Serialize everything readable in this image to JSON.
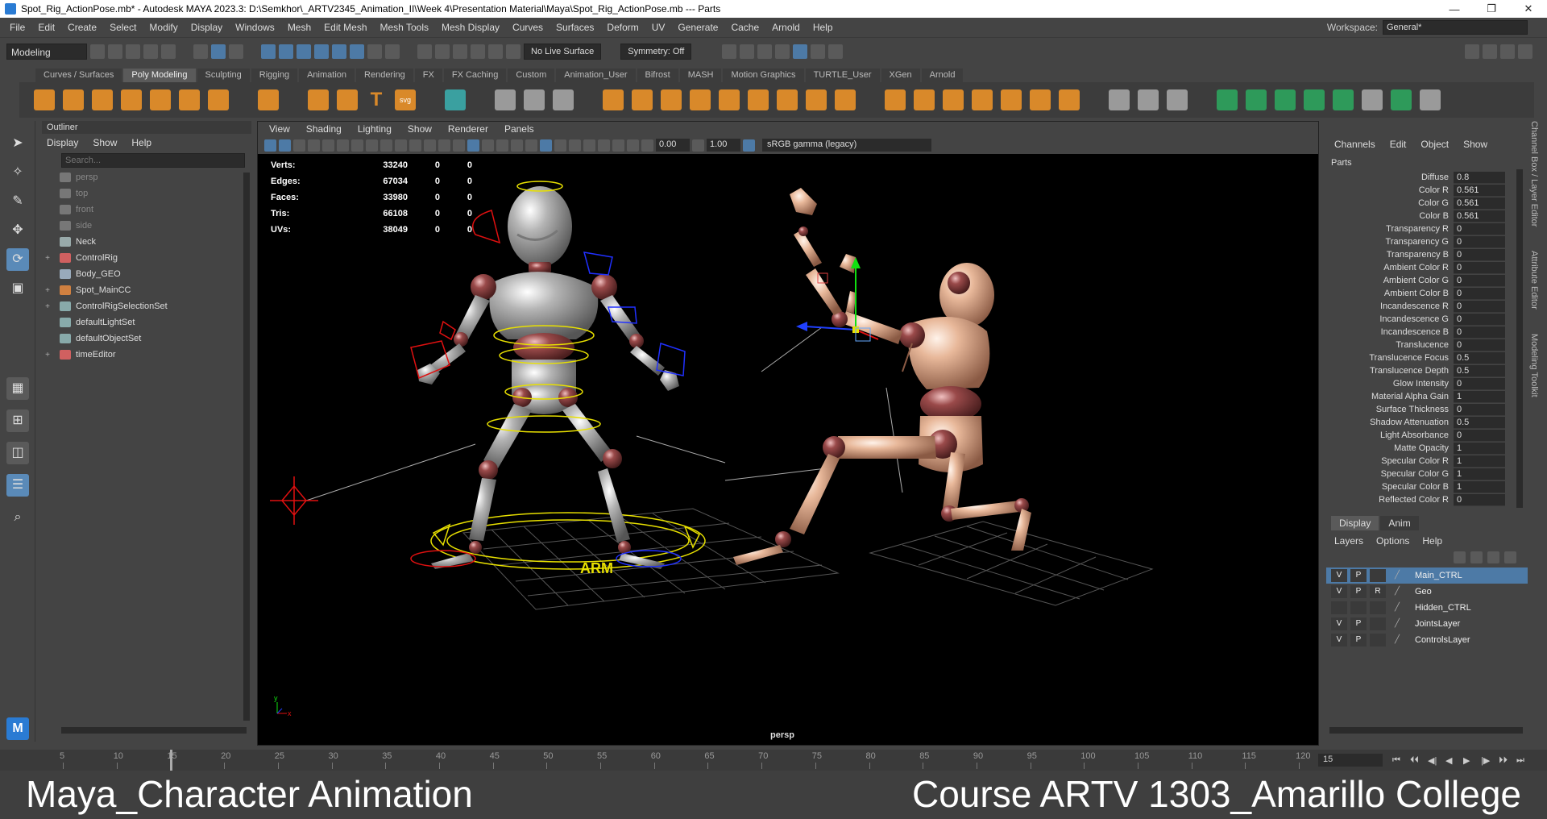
{
  "titlebar": {
    "title": "Spot_Rig_ActionPose.mb* - Autodesk MAYA 2023.3: D:\\Semkhor\\_ARTV2345_Animation_II\\Week 4\\Presentation Material\\Maya\\Spot_Rig_ActionPose.mb   ---   Parts",
    "min": "—",
    "max": "❐",
    "close": "✕"
  },
  "menubar": {
    "items": [
      "File",
      "Edit",
      "Create",
      "Select",
      "Modify",
      "Display",
      "Windows",
      "Mesh",
      "Edit Mesh",
      "Mesh Tools",
      "Mesh Display",
      "Curves",
      "Surfaces",
      "Deform",
      "UV",
      "Generate",
      "Cache",
      "Arnold",
      "Help"
    ],
    "workspace_label": "Workspace:",
    "workspace_value": "General*"
  },
  "statusline": {
    "mode": "Modeling",
    "live_surface": "No Live Surface",
    "symmetry": "Symmetry: Off"
  },
  "shelf": {
    "tabs": [
      "Curves / Surfaces",
      "Poly Modeling",
      "Sculpting",
      "Rigging",
      "Animation",
      "Rendering",
      "FX",
      "FX Caching",
      "Custom",
      "Animation_User",
      "Bifrost",
      "MASH",
      "Motion Graphics",
      "TURTLE_User",
      "XGen",
      "Arnold"
    ],
    "active": "Poly Modeling",
    "text_icon": "T",
    "svg_icon": "svg"
  },
  "outliner": {
    "title": "Outliner",
    "menu": [
      "Display",
      "Show",
      "Help"
    ],
    "search_placeholder": "Search...",
    "items": [
      {
        "label": "persp",
        "expand": "",
        "dim": true,
        "color": "#777"
      },
      {
        "label": "top",
        "expand": "",
        "dim": true,
        "color": "#777"
      },
      {
        "label": "front",
        "expand": "",
        "dim": true,
        "color": "#777"
      },
      {
        "label": "side",
        "expand": "",
        "dim": true,
        "color": "#777"
      },
      {
        "label": "Neck",
        "expand": "",
        "dim": false,
        "color": "#9aa"
      },
      {
        "label": "ControlRig",
        "expand": "+",
        "dim": false,
        "color": "#d06060"
      },
      {
        "label": "Body_GEO",
        "expand": "",
        "dim": false,
        "color": "#9ab"
      },
      {
        "label": "Spot_MainCC",
        "expand": "+",
        "dim": false,
        "color": "#d08040"
      },
      {
        "label": "ControlRigSelectionSet",
        "expand": "+",
        "dim": false,
        "color": "#8aa"
      },
      {
        "label": "defaultLightSet",
        "expand": "",
        "dim": false,
        "color": "#8aa"
      },
      {
        "label": "defaultObjectSet",
        "expand": "",
        "dim": false,
        "color": "#8aa"
      },
      {
        "label": "timeEditor",
        "expand": "+",
        "dim": false,
        "color": "#d06060"
      }
    ]
  },
  "viewport": {
    "menu": [
      "View",
      "Shading",
      "Lighting",
      "Show",
      "Renderer",
      "Panels"
    ],
    "near": "0.00",
    "far": "1.00",
    "color_space": "sRGB gamma (legacy)",
    "camera": "persp",
    "hud": [
      {
        "label": "Verts:",
        "v": "33240",
        "a": "0",
        "b": "0"
      },
      {
        "label": "Edges:",
        "v": "67034",
        "a": "0",
        "b": "0"
      },
      {
        "label": "Faces:",
        "v": "33980",
        "a": "0",
        "b": "0"
      },
      {
        "label": "Tris:",
        "v": "66108",
        "a": "0",
        "b": "0"
      },
      {
        "label": "UVs:",
        "v": "38049",
        "a": "0",
        "b": "0"
      }
    ],
    "axis_y": "y",
    "axis_x": "x",
    "ground_text": "ARM"
  },
  "channelbox": {
    "menu": [
      "Channels",
      "Edit",
      "Object",
      "Show"
    ],
    "object": "Parts",
    "attrs": [
      {
        "k": "Diffuse",
        "v": "0.8"
      },
      {
        "k": "Color R",
        "v": "0.561"
      },
      {
        "k": "Color G",
        "v": "0.561"
      },
      {
        "k": "Color B",
        "v": "0.561"
      },
      {
        "k": "Transparency R",
        "v": "0"
      },
      {
        "k": "Transparency G",
        "v": "0"
      },
      {
        "k": "Transparency B",
        "v": "0"
      },
      {
        "k": "Ambient Color R",
        "v": "0"
      },
      {
        "k": "Ambient Color G",
        "v": "0"
      },
      {
        "k": "Ambient Color B",
        "v": "0"
      },
      {
        "k": "Incandescence R",
        "v": "0"
      },
      {
        "k": "Incandescence G",
        "v": "0"
      },
      {
        "k": "Incandescence B",
        "v": "0"
      },
      {
        "k": "Translucence",
        "v": "0"
      },
      {
        "k": "Translucence Focus",
        "v": "0.5"
      },
      {
        "k": "Translucence Depth",
        "v": "0.5"
      },
      {
        "k": "Glow Intensity",
        "v": "0"
      },
      {
        "k": "Material Alpha Gain",
        "v": "1"
      },
      {
        "k": "Surface Thickness",
        "v": "0"
      },
      {
        "k": "Shadow Attenuation",
        "v": "0.5"
      },
      {
        "k": "Light Absorbance",
        "v": "0"
      },
      {
        "k": "Matte Opacity",
        "v": "1"
      },
      {
        "k": "Specular Color R",
        "v": "1"
      },
      {
        "k": "Specular Color G",
        "v": "1"
      },
      {
        "k": "Specular Color B",
        "v": "1"
      },
      {
        "k": "Reflected Color R",
        "v": "0"
      }
    ]
  },
  "layers": {
    "tabs": [
      "Display",
      "Anim"
    ],
    "menu": [
      "Layers",
      "Options",
      "Help"
    ],
    "rows": [
      {
        "v": "V",
        "p": "P",
        "r": "",
        "name": "Main_CTRL",
        "sel": true
      },
      {
        "v": "V",
        "p": "P",
        "r": "R",
        "name": "Geo",
        "sel": false
      },
      {
        "v": "",
        "p": "",
        "r": "",
        "name": "Hidden_CTRL",
        "sel": false
      },
      {
        "v": "V",
        "p": "P",
        "r": "",
        "name": "JointsLayer",
        "sel": false
      },
      {
        "v": "V",
        "p": "P",
        "r": "",
        "name": "ControlsLayer",
        "sel": false
      }
    ]
  },
  "sidetabs": [
    "Channel Box / Layer Editor",
    "Attribute Editor",
    "Modeling Toolkit"
  ],
  "timeslider": {
    "ticks": [
      "5",
      "10",
      "15",
      "20",
      "25",
      "30",
      "35",
      "40",
      "45",
      "50",
      "55",
      "60",
      "65",
      "70",
      "75",
      "80",
      "85",
      "90",
      "95",
      "100",
      "105",
      "110",
      "115",
      "120"
    ],
    "current": "15",
    "start_field": "15",
    "playback": [
      "⏮",
      "⏴⏴",
      "◀|",
      "◀",
      "▶",
      "|▶",
      "⏵⏵",
      "⏭"
    ]
  },
  "caption": {
    "left": "Maya_Character Animation",
    "right": "Course ARTV 1303_Amarillo College"
  }
}
